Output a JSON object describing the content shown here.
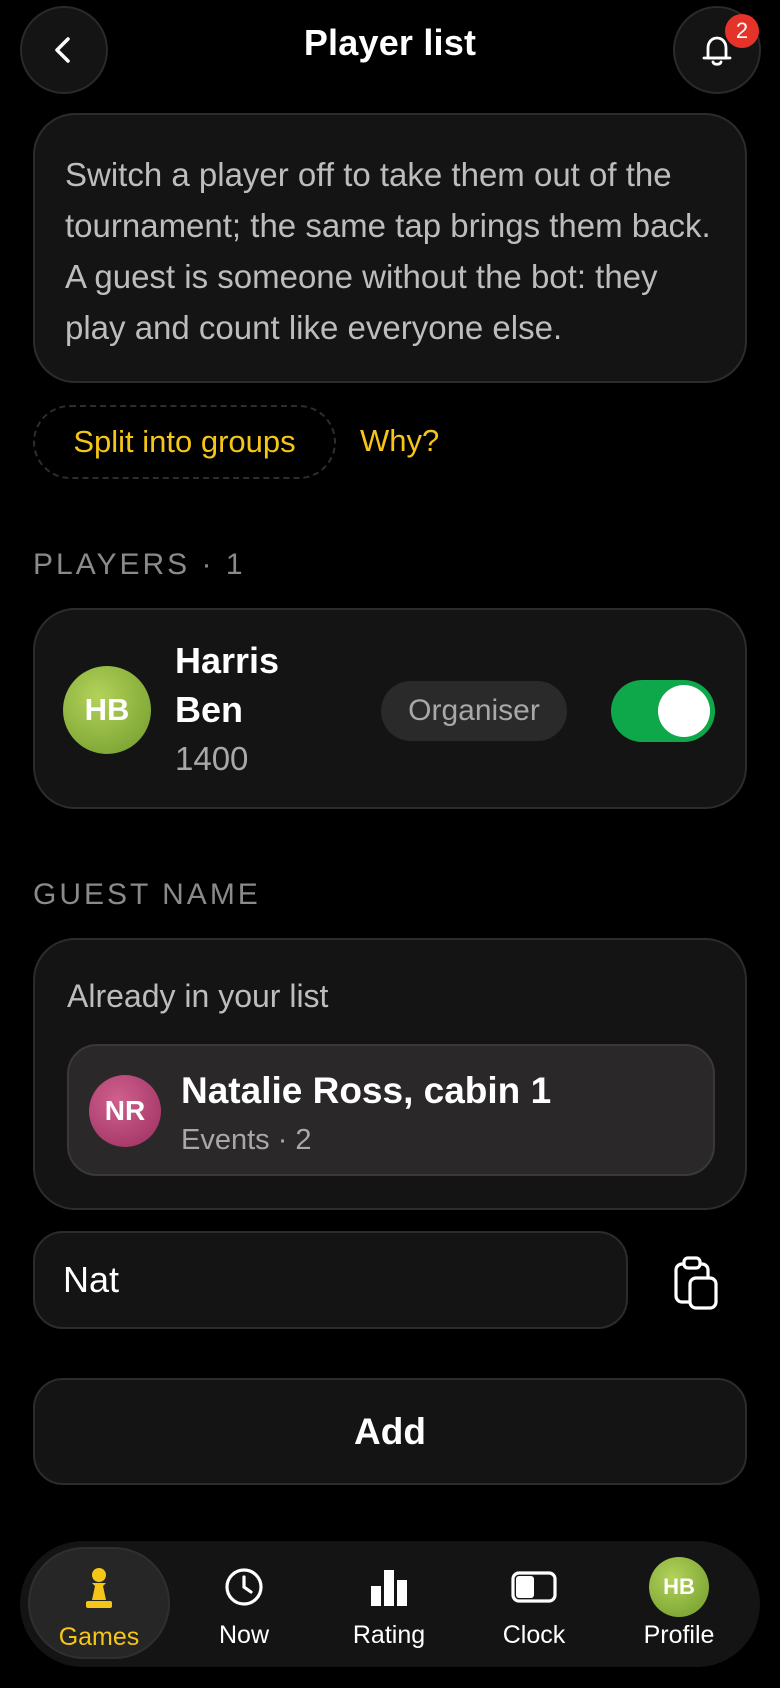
{
  "header": {
    "title": "Player list",
    "notification_count": "2"
  },
  "info": {
    "text": "Switch a player off to take them out of the tournament; the same tap brings them back. A guest is someone without the bot: they play and count like everyone else."
  },
  "actions": {
    "split_label": "Split into groups",
    "why_label": "Why?"
  },
  "players": {
    "section_label": "PLAYERS · 1",
    "items": [
      {
        "initials": "HB",
        "name": "Harris Ben",
        "rating": "1400",
        "role": "Organiser",
        "active": true
      }
    ]
  },
  "guest": {
    "section_label": "GUEST NAME",
    "already_label": "Already in your list",
    "suggestion": {
      "initials": "NR",
      "name": "Natalie Ross, cabin 1",
      "meta": "Events · 2"
    },
    "input_value": "Nat",
    "add_label": "Add"
  },
  "tabs": [
    {
      "label": "Games",
      "icon": "pawn-icon",
      "active": true
    },
    {
      "label": "Now",
      "icon": "clock-icon",
      "active": false
    },
    {
      "label": "Rating",
      "icon": "bar-chart-icon",
      "active": false
    },
    {
      "label": "Clock",
      "icon": "chess-clock-icon",
      "active": false
    },
    {
      "label": "Profile",
      "icon": "avatar",
      "avatar_initials": "HB",
      "active": false
    }
  ],
  "colors": {
    "accent": "#f5c518",
    "toggle_on": "#0ea84a",
    "badge": "#e5332a"
  }
}
